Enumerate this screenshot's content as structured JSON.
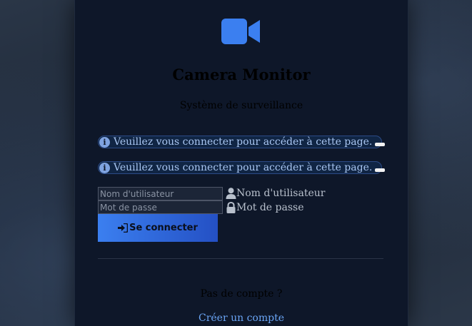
{
  "app": {
    "title": "Camera Monitor",
    "subtitle": "Système de surveillance",
    "logo_icon": "video-camera-icon"
  },
  "alerts": [
    {
      "icon": "info-circle-icon",
      "text": "Veuillez vous connecter pour accéder à cette page."
    },
    {
      "icon": "info-circle-icon",
      "text": "Veuillez vous connecter pour accéder à cette page."
    }
  ],
  "login_form": {
    "username": {
      "value": "",
      "placeholder": "Nom d'utilisateur",
      "label": "Nom d'utilisateur",
      "icon": "user-icon"
    },
    "password": {
      "value": "",
      "placeholder": "Mot de passe",
      "label": "Mot de passe",
      "icon": "lock-icon"
    },
    "submit": {
      "label": "Se connecter",
      "icon": "sign-in-icon"
    }
  },
  "footer": {
    "prompt": "Pas de compte ?",
    "register_link": "Créer un compte"
  },
  "colors": {
    "accent": "#3b7ff0",
    "card_bg": "#0e1729",
    "alert_text": "#a9c6f2",
    "link": "#6aa5f5"
  }
}
